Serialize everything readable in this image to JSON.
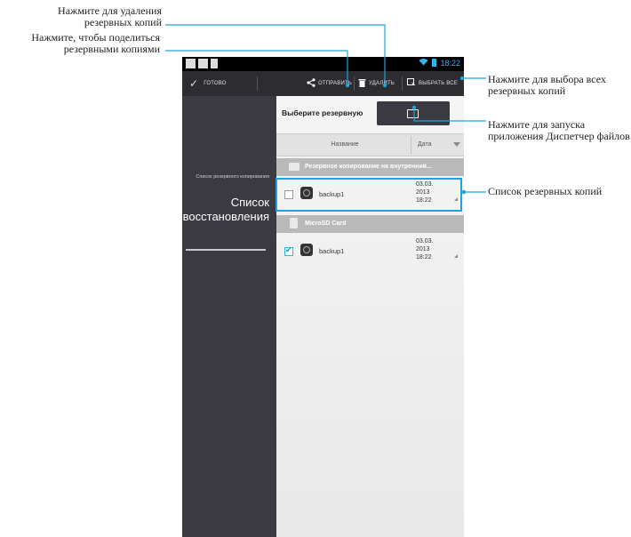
{
  "callouts": {
    "delete": "Нажмите для удаления резервных копий",
    "share": "Нажмите, чтобы поделиться резервными копиями",
    "select_all": "Нажмите для выбора всех резервных копий",
    "file_manager": "Нажмите для запуска приложения Диспетчер файлов",
    "backup_list": "Список резервных копий"
  },
  "status_bar": {
    "time": "18:22"
  },
  "action_bar": {
    "done_label": "ГОТОВО",
    "share_label": "ОТПРАВИТЬ",
    "delete_label": "УДАЛИТЬ",
    "select_all_label": "ВЫБРАТЬ ВСЕ"
  },
  "sidebar": {
    "small_label": "Список резервного копирования",
    "big_label": "Список восстановления"
  },
  "content": {
    "title": "Выберите резервную",
    "columns": {
      "name": "Название",
      "date": "Дата"
    },
    "sections": [
      {
        "label": "Резервное копирование на внутренний...",
        "rows": [
          {
            "name": "backup1",
            "date": "03.03.",
            "year": "2013",
            "time": "18:22",
            "checked": false
          }
        ]
      },
      {
        "label": "MicroSD Card",
        "rows": [
          {
            "name": "backup1",
            "date": "03.03.",
            "year": "2013",
            "time": "18:22",
            "checked": true
          }
        ]
      }
    ]
  },
  "colors": {
    "accent": "#33b5e5",
    "highlight": "#1ea4d8",
    "sidebar": "#3b3a43",
    "action_bar": "#2d2d31"
  }
}
